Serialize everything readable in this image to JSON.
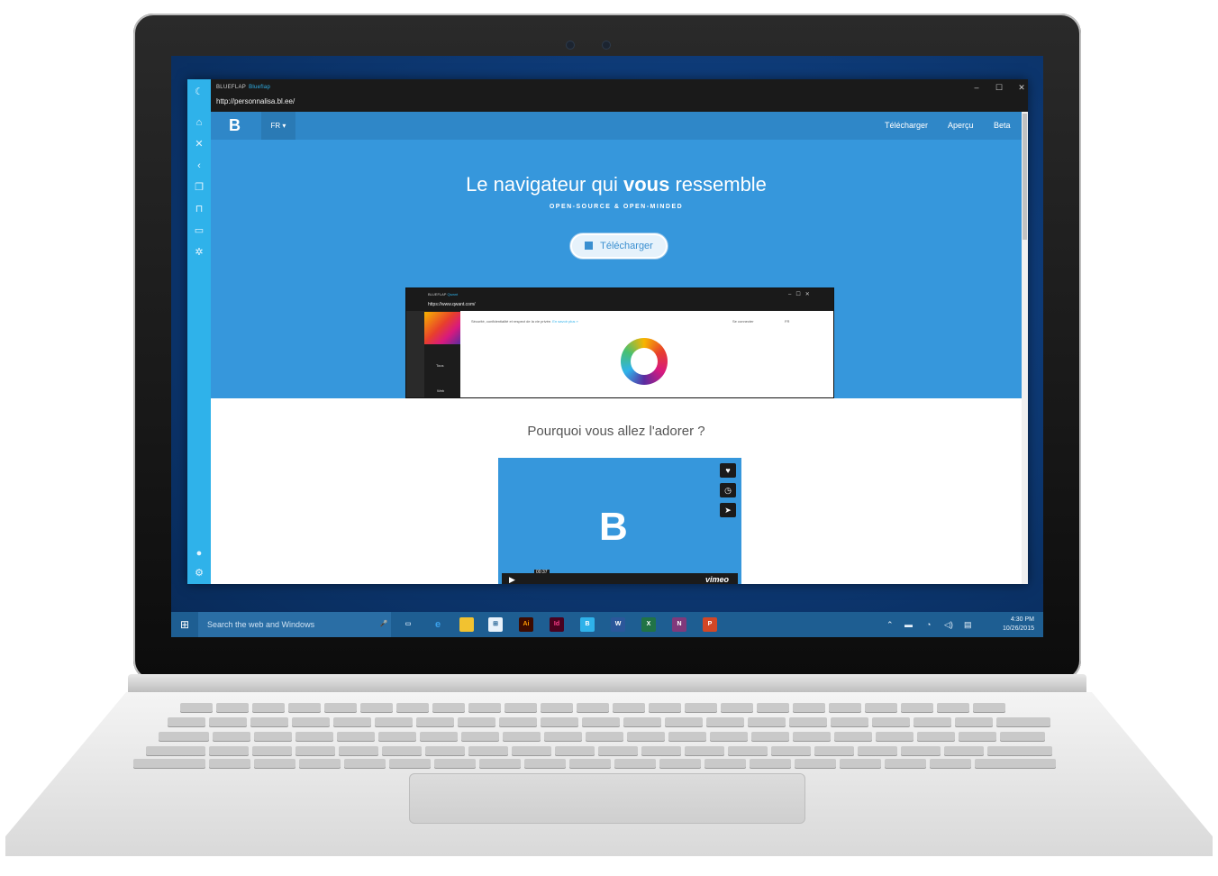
{
  "browser": {
    "app_name": "BLUEFLAP",
    "app_sub": "Blueflap",
    "url": "http://personnalisa.bl.ee/",
    "window_controls": [
      "–",
      "☐",
      "✕"
    ]
  },
  "site": {
    "brand": "B",
    "lang": "FR ▾",
    "nav": [
      "Télécharger",
      "Aperçu",
      "Beta"
    ],
    "headline_pre": "Le navigateur qui ",
    "headline_bold": "vous",
    "headline_post": " ressemble",
    "tagline": "OPEN-SOURCE & OPEN-MINDED",
    "download_button": "Télécharger",
    "why_title": "Pourquoi vous allez l'adorer ?"
  },
  "preview": {
    "app_name": "BLUEFLAP",
    "app_sub": "Qwant",
    "url": "https://www.qwant.com/",
    "notice": "Sécurité, confidentialité et respect de la vie privée.",
    "notice_link": "En savoir plus »",
    "signin": "Se connecter",
    "lang": "FR",
    "tabs": [
      "Tous",
      "Web"
    ]
  },
  "video": {
    "timestamp": "00:37",
    "provider": "vimeo",
    "logo": "B"
  },
  "taskbar": {
    "search_placeholder": "Search the web and Windows",
    "time": "4:30 PM",
    "date": "10/26/2015",
    "apps": [
      {
        "label": "Ai",
        "color": "#3d0b00"
      },
      {
        "label": "Id",
        "color": "#49021f"
      },
      {
        "label": "B",
        "color": "#2fb2ea"
      },
      {
        "label": "W",
        "color": "#2b579a"
      },
      {
        "label": "X",
        "color": "#217346"
      },
      {
        "label": "N",
        "color": "#80397b"
      },
      {
        "label": "P",
        "color": "#d24726"
      }
    ]
  },
  "colors": {
    "accent": "#3697dc",
    "sidebar": "#2fb2ea",
    "taskbar": "#1e5e92"
  }
}
